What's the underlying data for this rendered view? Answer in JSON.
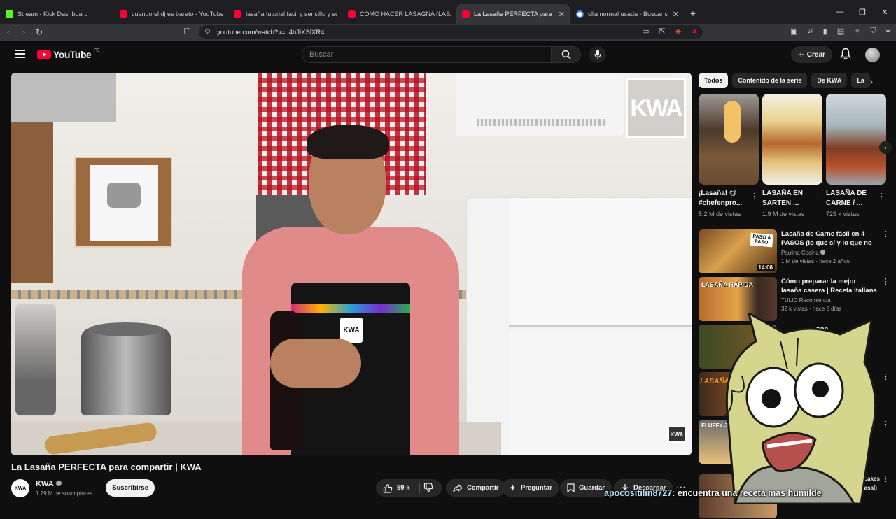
{
  "browser": {
    "tabs": [
      {
        "title": "Stream - Kick Dashboard",
        "favicon": "kick-icon"
      },
      {
        "title": "cuando el dj es barato - YouTube",
        "favicon": "youtube-icon"
      },
      {
        "title": "lasaña tutorial facil y sencillo y sobre t",
        "favicon": "youtube-icon"
      },
      {
        "title": "COMO HACER LASAGNA (LASAÑA) M",
        "favicon": "youtube-icon"
      },
      {
        "title": "La Lasaña PERFECTA para compar",
        "favicon": "youtube-icon",
        "active": true
      },
      {
        "title": "olla normal usada - Buscar con G",
        "favicon": "google-icon"
      }
    ],
    "url": "youtube.com/watch?v=n4hJiXSlXR4"
  },
  "youtube": {
    "logo_text": "YouTube",
    "region": "PE",
    "search_placeholder": "Buscar",
    "create_label": "Crear"
  },
  "video": {
    "title": "La Lasaña PERFECTA para compartir | KWA",
    "watermark": "KWA",
    "channel": "KWA",
    "subscribers": "1.79 M de suscriptores",
    "subscribe_label": "Suscribirse",
    "likes": "59 k",
    "share_label": "Compartir",
    "ask_label": "Preguntar",
    "save_label": "Guardar",
    "download_label": "Descargar"
  },
  "sidebar": {
    "chips": [
      "Todos",
      "Contenido de la serie",
      "De KWA",
      "La"
    ],
    "shorts": [
      {
        "title": "¡Lasaña! 😋 #chefenpro...",
        "views": "5.2 M de vistas"
      },
      {
        "title": "LASAÑA EN SARTEN ...",
        "views": "1.9 M de vistas"
      },
      {
        "title": "LASAÑA DE CARNE / ...",
        "views": "725 k vistas"
      }
    ],
    "recommended": [
      {
        "title": "Lasaña de Carne fácil en 4 PASOS (lo que sí y lo que no ...",
        "channel": "Paulina Cocina",
        "meta": "1 M de vistas · hace 2 años",
        "duration": "14:08",
        "thumb_text": "PASO A PASO"
      },
      {
        "title": "Cómo preparar la mejor lasaña casera | Receta italiana | Tulio ...",
        "channel": "TULIO Recomienda",
        "meta": "32 k vistas · hace 8 días",
        "duration": "",
        "thumb_text": "LASAÑA RÁPIDA"
      },
      {
        "title": "...pon",
        "channel": "",
        "meta": "",
        "duration": "",
        "thumb_text": ""
      },
      {
        "title": "",
        "channel": "",
        "meta": "",
        "duration": "",
        "thumb_text": "LASAÑA"
      },
      {
        "title": "",
        "channel": "",
        "meta": "",
        "duration": "",
        "thumb_text": "FLUFFY JAPA"
      },
      {
        "title": "...cakes ...asal)",
        "channel": "",
        "meta": "",
        "duration": "",
        "thumb_text": ""
      }
    ]
  },
  "chat": {
    "user": "apocositilin8727:",
    "message": "encuentra una receta mas humilde"
  }
}
